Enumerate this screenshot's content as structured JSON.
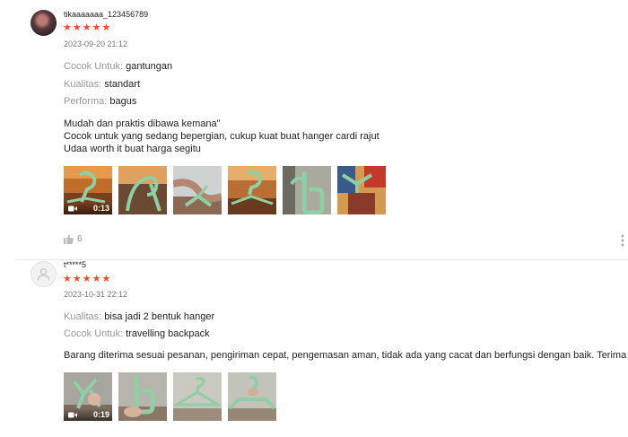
{
  "reviews": [
    {
      "username": "tikaaaaaaa_123456789",
      "stars": "★★★★★",
      "date": "2023-09-20 21:12",
      "attributes": [
        {
          "key": "Cocok Untuk:",
          "value": "gantungan"
        },
        {
          "key": "Kualitas:",
          "value": "standart"
        },
        {
          "key": "Performa:",
          "value": "bagus"
        }
      ],
      "text_lines": [
        "Mudah dan praktis dibawa kemana\"",
        "Cocok untuk yang sedang bepergian, cukup kuat buat hanger cardi rajut",
        "Udaa worth it buat harga segitu"
      ],
      "video_duration": "0:13",
      "likes": "6",
      "photo_count": 6
    },
    {
      "username": "t*****5",
      "stars": "★★★★★",
      "date": "2023-10-31 22:12",
      "attributes": [
        {
          "key": "Kualitas:",
          "value": "bisa jadi 2 bentuk hanger"
        },
        {
          "key": "Cocok Untuk:",
          "value": "travelling backpack"
        }
      ],
      "text_lines": [
        "Barang diterima sesuai pesanan, pengiriman cepat, pengemasan aman, tidak ada yang cacat dan berfungsi dengan baik. Terima kasih!"
      ],
      "video_duration": "0:19",
      "photo_count": 4
    }
  ],
  "colors": {
    "star": "#ee4d2d",
    "hanger": "#8fcfa3"
  }
}
